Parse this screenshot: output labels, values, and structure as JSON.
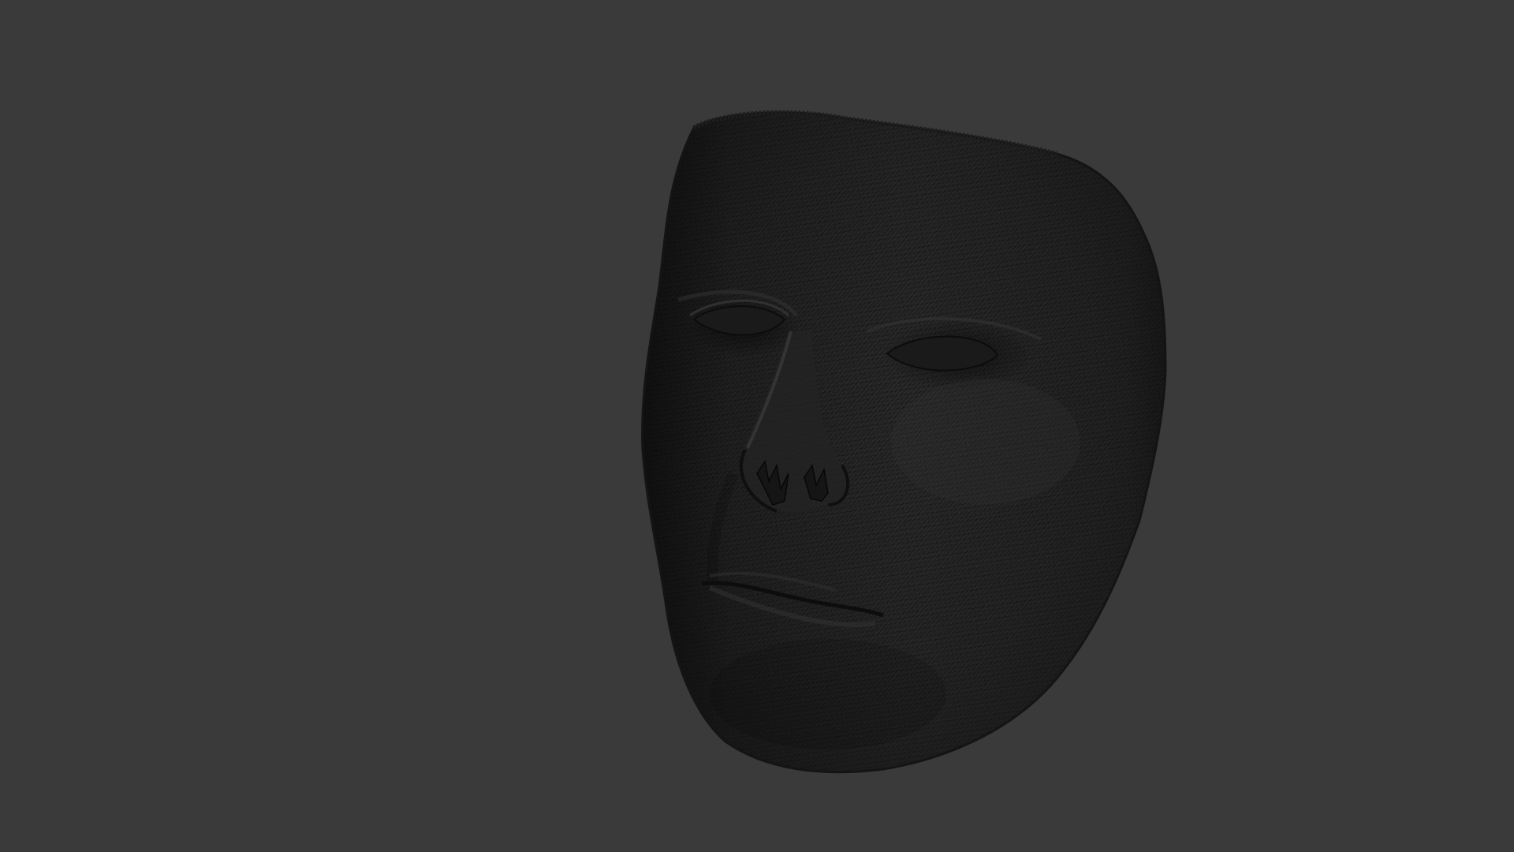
{
  "viewport": {
    "background_color": "#3a3a3a",
    "model": {
      "kind": "face-mask-mesh",
      "render_mode": "wireframe-on-shaded",
      "surface_color": "#262626",
      "wire_color": "#101010"
    }
  }
}
